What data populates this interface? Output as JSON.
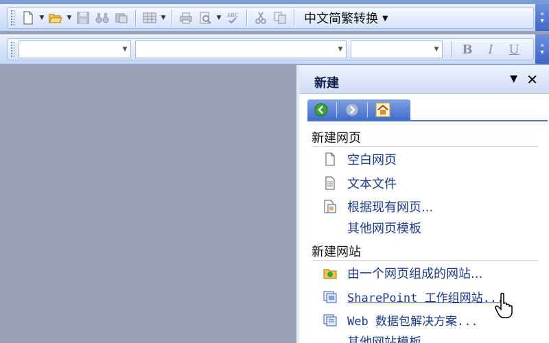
{
  "toolbar_standard": {
    "buttons": [
      {
        "name": "new-document",
        "icon": "new-document-icon"
      },
      {
        "name": "open-folder",
        "icon": "open-folder-icon"
      },
      {
        "name": "save",
        "icon": "save-icon"
      },
      {
        "name": "find",
        "icon": "binoculars-icon"
      },
      {
        "name": "publish",
        "icon": "publish-icon"
      },
      {
        "name": "table",
        "icon": "table-icon"
      },
      {
        "name": "print",
        "icon": "print-icon"
      },
      {
        "name": "print-preview",
        "icon": "print-preview-icon"
      },
      {
        "name": "spelling",
        "icon": "spelling-icon"
      },
      {
        "name": "cut",
        "icon": "scissors-icon"
      },
      {
        "name": "copy",
        "icon": "copy-icon"
      }
    ],
    "conversion_label": "中文简繁转换"
  },
  "toolbar_formatting": {
    "style_value": "",
    "font_value": "",
    "size_value": "",
    "bold_label": "B",
    "italic_label": "I",
    "underline_label": "U"
  },
  "task_pane": {
    "title": "新建",
    "menu_glyph": "▼",
    "close_glyph": "✕",
    "nav": {
      "back_icon": "back-arrow-icon",
      "forward_icon": "forward-arrow-icon",
      "home_icon": "home-icon"
    },
    "sections": [
      {
        "heading": "新建网页",
        "items": [
          {
            "label": "空白网页",
            "icon": "blank-page-icon"
          },
          {
            "label": "文本文件",
            "icon": "text-file-icon"
          },
          {
            "label": "根据现有网页...",
            "icon": "existing-page-icon"
          },
          {
            "label": "其他网页模板",
            "icon": ""
          }
        ]
      },
      {
        "heading": "新建网站",
        "items": [
          {
            "label": "由一个网页组成的网站...",
            "icon": "single-page-site-icon"
          },
          {
            "label": "SharePoint 工作组网站...",
            "icon": "sharepoint-site-icon"
          },
          {
            "label": "Web 数据包解决方案...",
            "icon": "web-package-icon"
          },
          {
            "label": "其他网站模板",
            "icon": ""
          }
        ]
      }
    ]
  },
  "colors": {
    "workspace": "#9b9fb6",
    "link": "#1b3a8c",
    "nav_strip": "#416ecb"
  }
}
